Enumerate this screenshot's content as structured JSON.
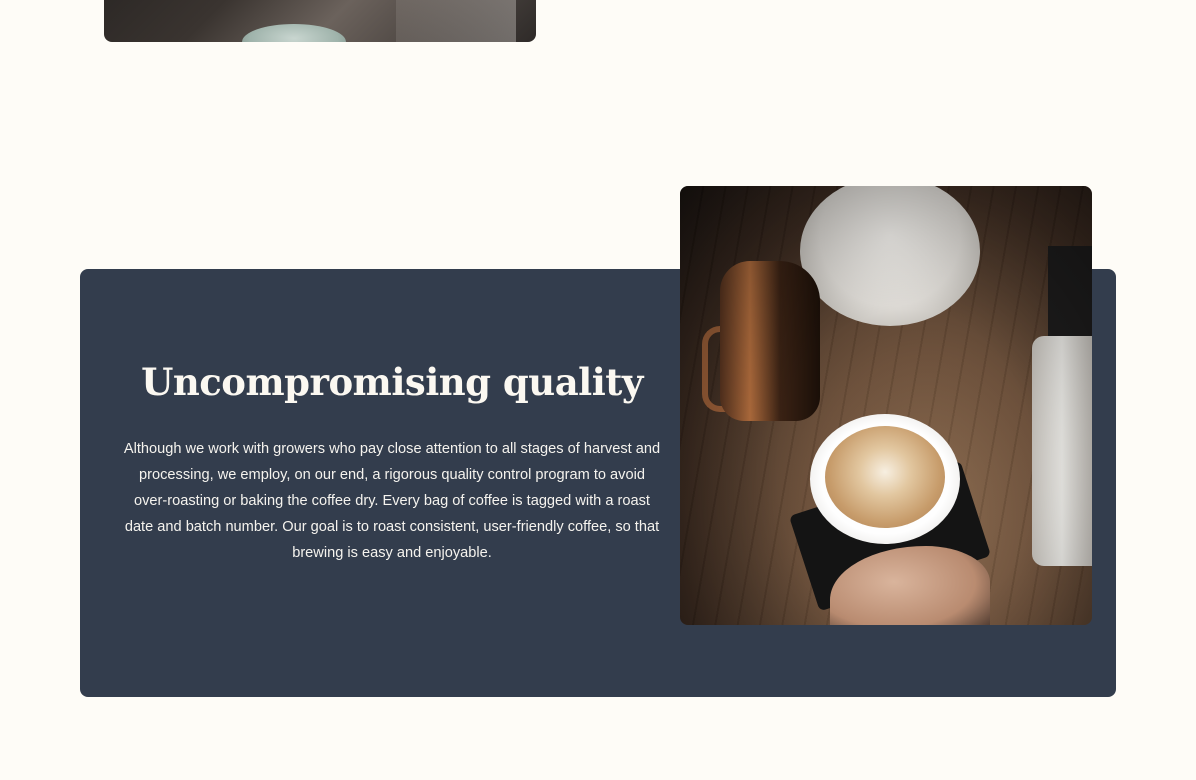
{
  "quality_section": {
    "heading": "Uncompromising quality",
    "body": "Although we work with growers who pay close attention to all stages of harvest and processing, we employ, on our end, a rigorous quality control program to avoid over-roasting or baking the coffee dry. Every bag of coffee is tagged with a roast date and batch number. Our goal is to roast consistent, user-friendly coffee, so that brewing is easy and enjoyable."
  },
  "colors": {
    "page_background": "#fefcf7",
    "card_background": "#333d4d",
    "heading_text": "#fbf8f1"
  }
}
